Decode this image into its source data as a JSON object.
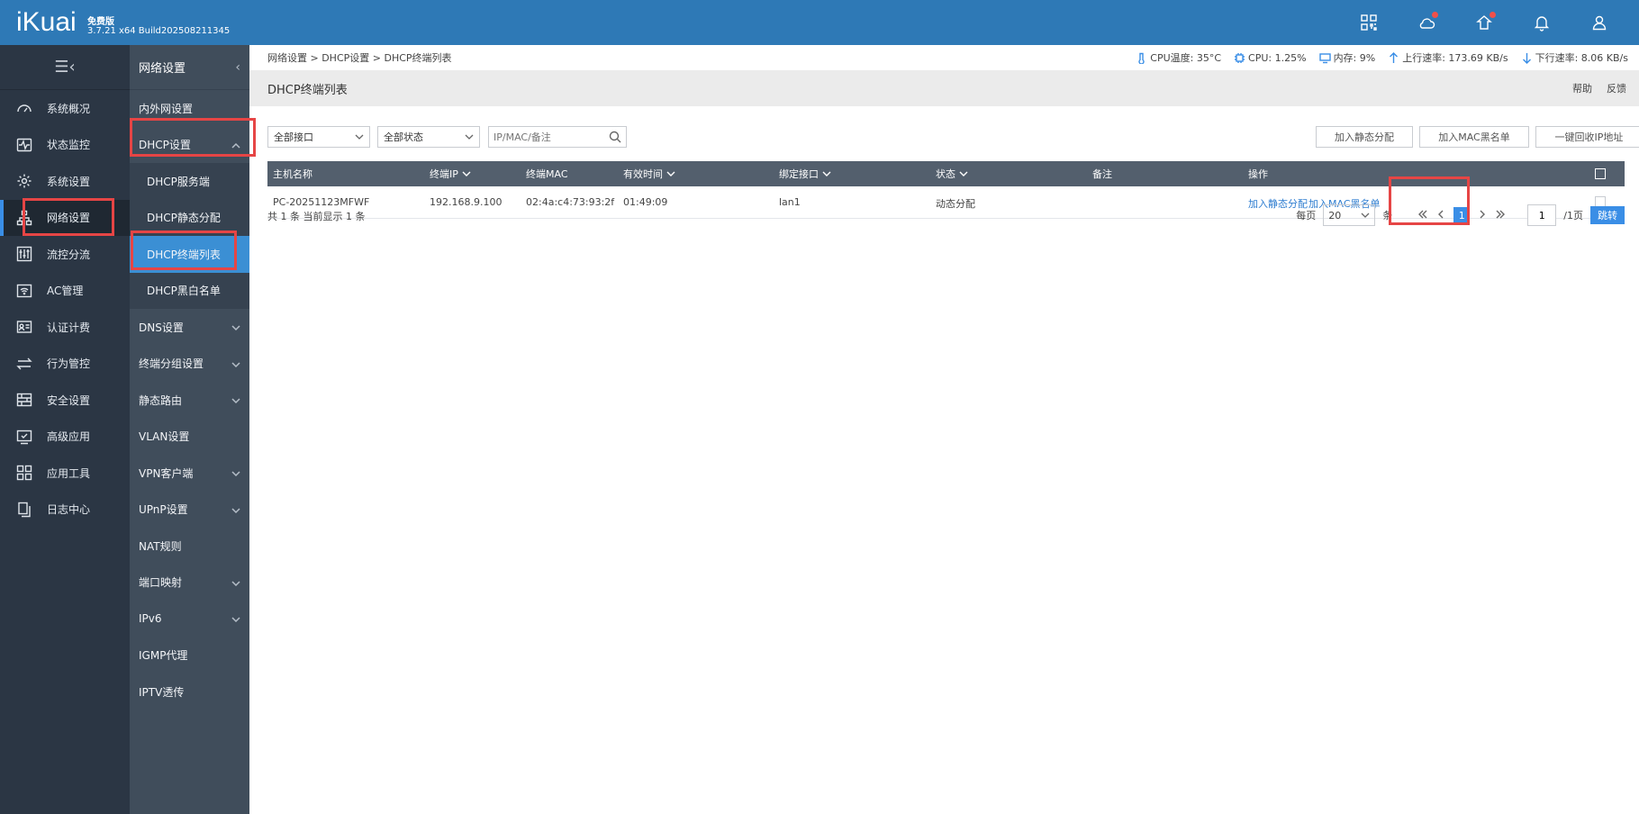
{
  "topbar": {
    "logo": "iKuai",
    "edition": "免费版",
    "version": "3.7.21 x64 Build202508211345",
    "icons": [
      "qrcode-icon",
      "cloud-icon",
      "upgrade-icon",
      "bell-icon",
      "user-icon"
    ]
  },
  "sidebar1": {
    "items": [
      {
        "label": "系统概况",
        "icon": "dashboard-icon"
      },
      {
        "label": "状态监控",
        "icon": "pulse-icon"
      },
      {
        "label": "系统设置",
        "icon": "gear-icon"
      },
      {
        "label": "网络设置",
        "icon": "network-icon",
        "active": true
      },
      {
        "label": "流控分流",
        "icon": "sliders-icon"
      },
      {
        "label": "AC管理",
        "icon": "wifi-icon"
      },
      {
        "label": "认证计费",
        "icon": "id-card-icon"
      },
      {
        "label": "行为管控",
        "icon": "swap-icon"
      },
      {
        "label": "安全设置",
        "icon": "firewall-icon"
      },
      {
        "label": "高级应用",
        "icon": "check-window-icon"
      },
      {
        "label": "应用工具",
        "icon": "grid-icon"
      },
      {
        "label": "日志中心",
        "icon": "copy-icon"
      }
    ]
  },
  "sidebar2": {
    "header": "网络设置",
    "items": [
      {
        "label": "内外网设置"
      },
      {
        "label": "DHCP设置",
        "expanded": true,
        "children": [
          {
            "label": "DHCP服务端"
          },
          {
            "label": "DHCP静态分配"
          },
          {
            "label": "DHCP终端列表",
            "active": true
          },
          {
            "label": "DHCP黑白名单"
          }
        ]
      },
      {
        "label": "DNS设置",
        "has_arrow": true
      },
      {
        "label": "终端分组设置",
        "has_arrow": true
      },
      {
        "label": "静态路由",
        "has_arrow": true
      },
      {
        "label": "VLAN设置"
      },
      {
        "label": "VPN客户端",
        "has_arrow": true
      },
      {
        "label": "UPnP设置",
        "has_arrow": true
      },
      {
        "label": "NAT规则"
      },
      {
        "label": "端口映射",
        "has_arrow": true
      },
      {
        "label": "IPv6",
        "has_arrow": true
      },
      {
        "label": "IGMP代理"
      },
      {
        "label": "IPTV透传"
      }
    ]
  },
  "breadcrumb": "网络设置 > DHCP设置 > DHCP终端列表",
  "stats": {
    "cpu_temp": "CPU温度: 35°C",
    "cpu": "CPU: 1.25%",
    "mem": "内存: 9%",
    "up": "上行速率: 173.69 KB/s",
    "down": "下行速率: 8.06 KB/s"
  },
  "page": {
    "title": "DHCP终端列表",
    "help": "帮助",
    "feedback": "反馈"
  },
  "toolbar": {
    "interface_select": "全部接口",
    "status_select": "全部状态",
    "search_placeholder": "IP/MAC/备注",
    "btn_static": "加入静态分配",
    "btn_blacklist": "加入MAC黑名单",
    "btn_reclaim": "一键回收IP地址"
  },
  "table": {
    "headers": {
      "hostname": "主机名称",
      "ip": "终端IP",
      "mac": "终端MAC",
      "lease": "有效时间",
      "iface": "绑定接口",
      "status": "状态",
      "note": "备注",
      "action": "操作"
    },
    "rows": [
      {
        "hostname": "PC-20251123MFWF",
        "ip": "192.168.9.100",
        "mac": "02:4a:c4:73:93:2f",
        "lease": "01:49:09",
        "iface": "lan1",
        "status": "动态分配",
        "note": "",
        "action_static": "加入静态分配",
        "action_blacklist": "加入MAC黑名单"
      }
    ]
  },
  "footer": {
    "summary": "共 1 条 当前显示 1 条",
    "per_page_label": "每页",
    "per_page": "20",
    "per_page_unit": "条",
    "current_page": "1",
    "goto_value": "1",
    "total_pages": "/1页",
    "go_label": "跳转"
  },
  "colors": {
    "topbar": "#2e79b6",
    "sidebar1": "#2b3644",
    "sidebar2": "#404d5b",
    "active": "#3b8fd4",
    "highlight": "#e64545"
  }
}
